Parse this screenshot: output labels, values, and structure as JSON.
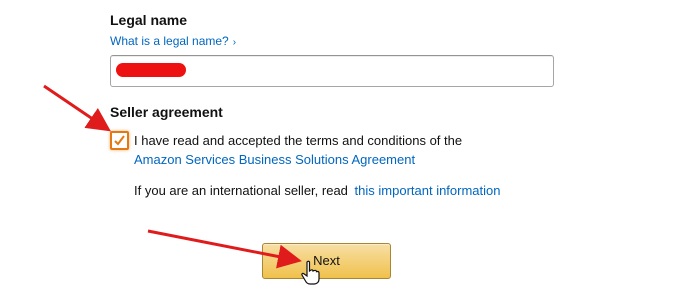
{
  "legal_name": {
    "title": "Legal name",
    "help_link": "What is a legal name?",
    "help_link_chevron": "›",
    "input_value": ""
  },
  "seller_agreement": {
    "title": "Seller agreement",
    "checked": true,
    "text": "I have read and accepted the terms and conditions of the",
    "link": "Amazon Services Business Solutions Agreement",
    "intl_text": "If you are an international seller, read",
    "intl_link": "this important information"
  },
  "actions": {
    "next_label": "Next"
  },
  "colors": {
    "link": "#0066c0",
    "checkbox_border": "#e47911",
    "button_top": "#f7dfa5",
    "button_bottom": "#f0c14b",
    "annotation_arrow": "#e01b1b"
  },
  "icons": [
    "checkmark-icon",
    "chevron-right-icon",
    "hand-cursor-icon",
    "annotation-arrow-icon"
  ]
}
